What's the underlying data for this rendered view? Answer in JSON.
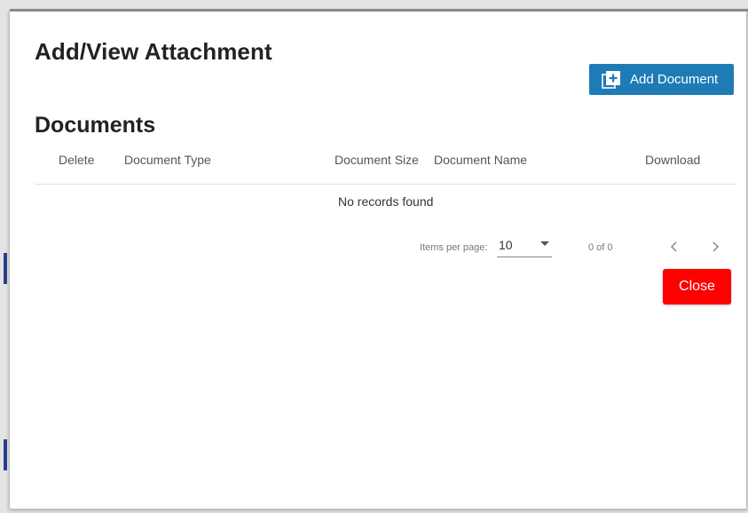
{
  "dialog": {
    "title": "Add/View Attachment",
    "add_document_label": "Add Document",
    "section_title": "Documents",
    "columns": [
      "Delete",
      "Document Type",
      "Document Size",
      "Document Name",
      "Download"
    ],
    "empty_message": "No records found",
    "paginator": {
      "items_per_page_label": "Items per page:",
      "items_per_page_value": "10",
      "range_label": "0 of 0"
    },
    "close_label": "Close"
  },
  "colors": {
    "primary_button": "#1e7bb6",
    "close_button": "#fd0000"
  },
  "icons": {
    "add": "add-box-icon",
    "prev": "chevron-left-icon",
    "next": "chevron-right-icon",
    "dropdown": "caret-down-icon"
  }
}
